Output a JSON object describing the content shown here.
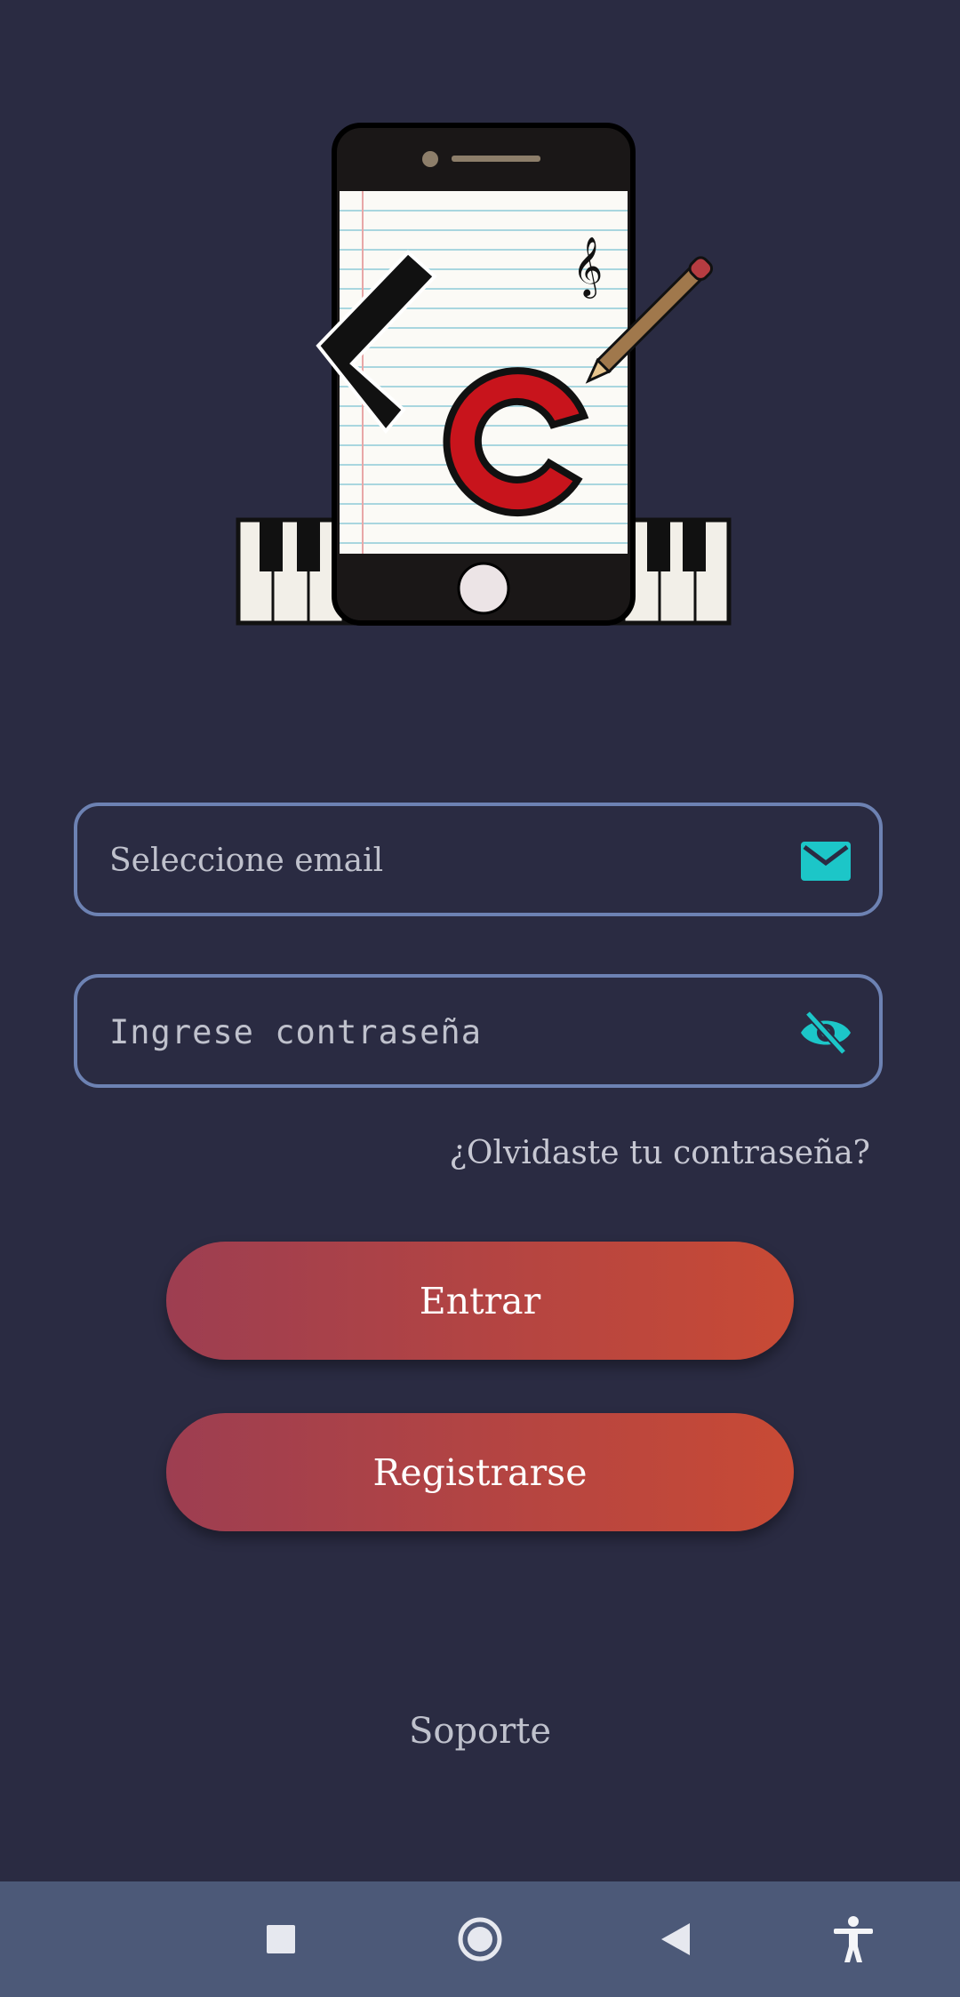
{
  "login": {
    "email_placeholder": "Seleccione email",
    "password_placeholder": "Ingrese contraseña",
    "forgot_label": "¿Olvidaste tu contraseña?",
    "login_label": "Entrar",
    "register_label": "Registrarse",
    "support_label": "Soporte"
  },
  "icons": {
    "email": "mail-icon",
    "password_toggle": "eye-off-icon",
    "logo": "app-logo"
  },
  "nav": {
    "items": [
      "square-recent-icon",
      "circle-home-icon",
      "triangle-back-icon",
      "accessibility-icon"
    ]
  },
  "colors": {
    "background": "#2a2b42",
    "field_border": "#6d82b3",
    "accent_icon": "#1cc6c8",
    "button_gradient_start": "#9d3e51",
    "button_gradient_end": "#c84a35",
    "navbar": "#4c5978"
  }
}
